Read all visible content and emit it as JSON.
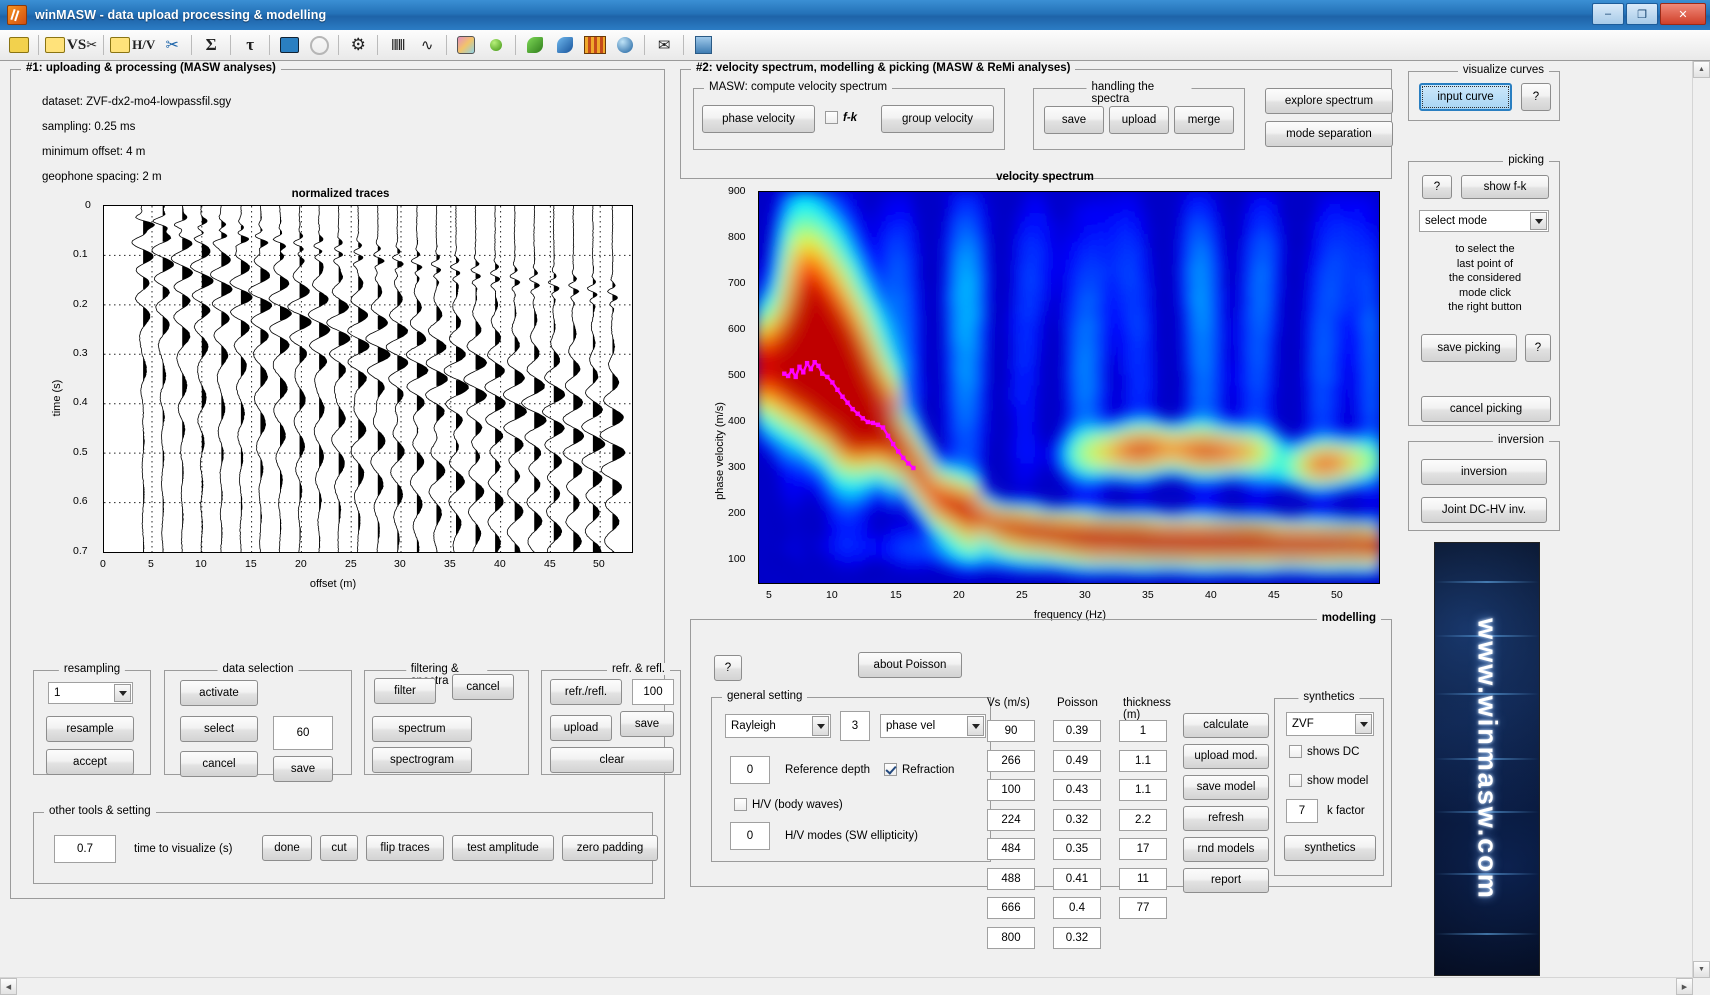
{
  "window": {
    "title": "winMASW - data upload processing & modelling",
    "minimize": "–",
    "maximize": "❐",
    "close": "✕"
  },
  "toolbar": {
    "items": [
      {
        "name": "open-project-icon",
        "glyph": "🗀"
      },
      {
        "name": "open-vs-icon",
        "glyph": "VS"
      },
      {
        "name": "open-hv-icon",
        "glyph": "H/V"
      },
      {
        "name": "scissors-icon",
        "glyph": "✂"
      },
      {
        "name": "sum-icon",
        "glyph": "Σ"
      },
      {
        "name": "tau-icon",
        "glyph": "τ"
      },
      {
        "name": "movie-icon",
        "glyph": "🎬"
      },
      {
        "name": "disc-icon",
        "glyph": "◎"
      },
      {
        "name": "gear-icon",
        "glyph": "⚙"
      },
      {
        "name": "waveform-icon",
        "glyph": "‖‖"
      },
      {
        "name": "pulse-icon",
        "glyph": "⌇"
      },
      {
        "name": "map-icon",
        "glyph": "▤"
      },
      {
        "name": "green-dot-icon",
        "glyph": "●"
      },
      {
        "name": "green-book-icon",
        "glyph": "◆"
      },
      {
        "name": "blue-book-icon",
        "glyph": "◆"
      },
      {
        "name": "books-icon",
        "glyph": "▥"
      },
      {
        "name": "globe-icon",
        "glyph": "◔"
      },
      {
        "name": "mail-icon",
        "glyph": "✉"
      },
      {
        "name": "exit-icon",
        "glyph": "⇥"
      }
    ]
  },
  "panel1": {
    "title": "#1: uploading & processing (MASW analyses)",
    "info": {
      "dataset": "dataset: ZVF-dx2-mo4-lowpassfil.sgy",
      "sampling": "sampling: 0.25 ms",
      "min_offset": "minimum offset: 4 m",
      "geophone_spacing": "geophone spacing: 2 m"
    },
    "resampling": {
      "title": "resampling",
      "value": "1",
      "resample_label": "resample",
      "accept_label": "accept"
    },
    "data_selection": {
      "title": "data selection",
      "activate_label": "activate",
      "select_label": "select",
      "cancel_label": "cancel",
      "save_label": "save",
      "value": "60"
    },
    "filtering": {
      "title": "filtering & spectra",
      "filter_label": "filter",
      "cancel_label": "cancel",
      "spectrum_label": "spectrum",
      "spectrogram_label": "spectrogram"
    },
    "refr_refl": {
      "title": "refr. & refl.",
      "refr_label": "refr./refl.",
      "value": "100",
      "upload_label": "upload",
      "save_label": "save",
      "clear_label": "clear"
    },
    "other_tools": {
      "title": "other tools & setting",
      "time_value": "0.7",
      "time_label": "time to visualize (s)",
      "done_label": "done",
      "cut_label": "cut",
      "flip_label": "flip traces",
      "test_label": "test amplitude",
      "zero_label": "zero padding"
    }
  },
  "panel2": {
    "title": "#2: velocity spectrum, modelling & picking (MASW & ReMi analyses)",
    "masw": {
      "title": "MASW: compute velocity spectrum",
      "phase_velocity_label": "phase velocity",
      "fk_label": "f-k",
      "fk_checked": false,
      "group_velocity_label": "group velocity"
    },
    "spectra": {
      "title": "handling the spectra",
      "save_label": "save",
      "upload_label": "upload",
      "merge_label": "merge"
    },
    "explore_label": "explore spectrum",
    "mode_separation_label": "mode separation"
  },
  "sidebar": {
    "visualize": {
      "title": "visualize curves",
      "input_curve_label": "input curve",
      "help_label": "?"
    },
    "picking": {
      "title": "picking",
      "help_label": "?",
      "show_fk_label": "show f-k",
      "select_mode": "select mode",
      "hint": "to select the\nlast point of\nthe considered\nmode click\nthe right button",
      "hint_lines": [
        "to select the",
        "last point of",
        "the considered",
        "mode click",
        "the right button"
      ],
      "save_picking_label": "save picking",
      "help2_label": "?",
      "cancel_picking_label": "cancel picking"
    },
    "inversion": {
      "title": "inversion",
      "inversion_label": "inversion",
      "joint_label": "Joint DC-HV inv."
    },
    "banner_text": "www.winmasw.com"
  },
  "modelling": {
    "title": "modelling",
    "help_label": "?",
    "about_poisson_label": "about Poisson",
    "general_setting": {
      "title": "general setting",
      "wave_type": "Rayleigh",
      "modes": "3",
      "velocity_type": "phase vel",
      "reference_depth_value": "0",
      "reference_depth_label": "Reference depth",
      "refraction_label": "Refraction",
      "refraction_checked": true,
      "hv_body_label": "H/V (body waves)",
      "hv_body_checked": false,
      "hv_modes_value": "0",
      "hv_modes_label": "H/V modes (SW ellipticity)"
    },
    "table": {
      "headers": [
        "Vs (m/s)",
        "Poisson",
        "thickness (m)"
      ],
      "vs": [
        "90",
        "266",
        "100",
        "224",
        "484",
        "488",
        "666",
        "800"
      ],
      "poisson": [
        "0.39",
        "0.49",
        "0.43",
        "0.32",
        "0.35",
        "0.41",
        "0.4",
        "0.32"
      ],
      "thickness": [
        "1",
        "1.1",
        "1.1",
        "2.2",
        "17",
        "11",
        "77"
      ]
    },
    "actions": {
      "calculate_label": "calculate",
      "upload_mod_label": "upload mod.",
      "save_model_label": "save model",
      "refresh_label": "refresh",
      "rnd_models_label": "rnd models",
      "report_label": "report"
    },
    "synthetics": {
      "title": "synthetics",
      "source": "ZVF",
      "shows_dc_label": "shows DC",
      "shows_dc_checked": false,
      "show_model_label": "show model",
      "show_model_checked": false,
      "k_factor_value": "7",
      "k_factor_label": "k factor",
      "synthetics_label": "synthetics"
    }
  },
  "chart_data": [
    {
      "type": "line",
      "name": "normalized-traces",
      "title": "normalized traces",
      "xlabel": "offset (m)",
      "ylabel": "time (s)",
      "xlim": [
        0,
        54
      ],
      "ylim": [
        0,
        0.7
      ],
      "y_inverted": true,
      "xticks": [
        0,
        5,
        10,
        15,
        20,
        25,
        30,
        35,
        40,
        45,
        50
      ],
      "yticks": [
        0,
        0.1,
        0.2,
        0.3,
        0.4,
        0.5,
        0.6,
        0.7
      ],
      "grid": true,
      "n_traces": 25,
      "trace_spacing_m": 2,
      "first_offset_m": 4,
      "description": "wiggle-variable-area seismic traces, positive lobes filled black"
    },
    {
      "type": "heatmap",
      "name": "velocity-spectrum",
      "title": "velocity spectrum",
      "xlabel": "frequency (Hz)",
      "ylabel": "phase velocity (m/s)",
      "xlim": [
        3,
        52
      ],
      "ylim": [
        50,
        900
      ],
      "xticks": [
        5,
        10,
        15,
        20,
        25,
        30,
        35,
        40,
        45,
        50
      ],
      "yticks": [
        100,
        200,
        300,
        400,
        500,
        600,
        700,
        800,
        900
      ],
      "colormap": "jet",
      "grid": false,
      "picked_curve": {
        "name": "picked dispersion curve",
        "color": "#ff00ff",
        "points": [
          [
            5.0,
            505
          ],
          [
            5.3,
            500
          ],
          [
            5.6,
            512
          ],
          [
            5.9,
            498
          ],
          [
            6.2,
            520
          ],
          [
            6.5,
            508
          ],
          [
            6.8,
            528
          ],
          [
            7.1,
            515
          ],
          [
            7.4,
            530
          ],
          [
            7.7,
            522
          ],
          [
            8.0,
            505
          ],
          [
            8.4,
            498
          ],
          [
            8.8,
            486
          ],
          [
            9.2,
            470
          ],
          [
            9.6,
            455
          ],
          [
            10.0,
            442
          ],
          [
            10.4,
            428
          ],
          [
            10.8,
            418
          ],
          [
            11.2,
            408
          ],
          [
            11.6,
            400
          ],
          [
            12.0,
            398
          ],
          [
            12.4,
            394
          ],
          [
            12.8,
            388
          ],
          [
            13.2,
            370
          ],
          [
            13.6,
            352
          ],
          [
            14.0,
            336
          ],
          [
            14.4,
            322
          ],
          [
            14.8,
            310
          ],
          [
            15.2,
            300
          ]
        ]
      }
    }
  ]
}
